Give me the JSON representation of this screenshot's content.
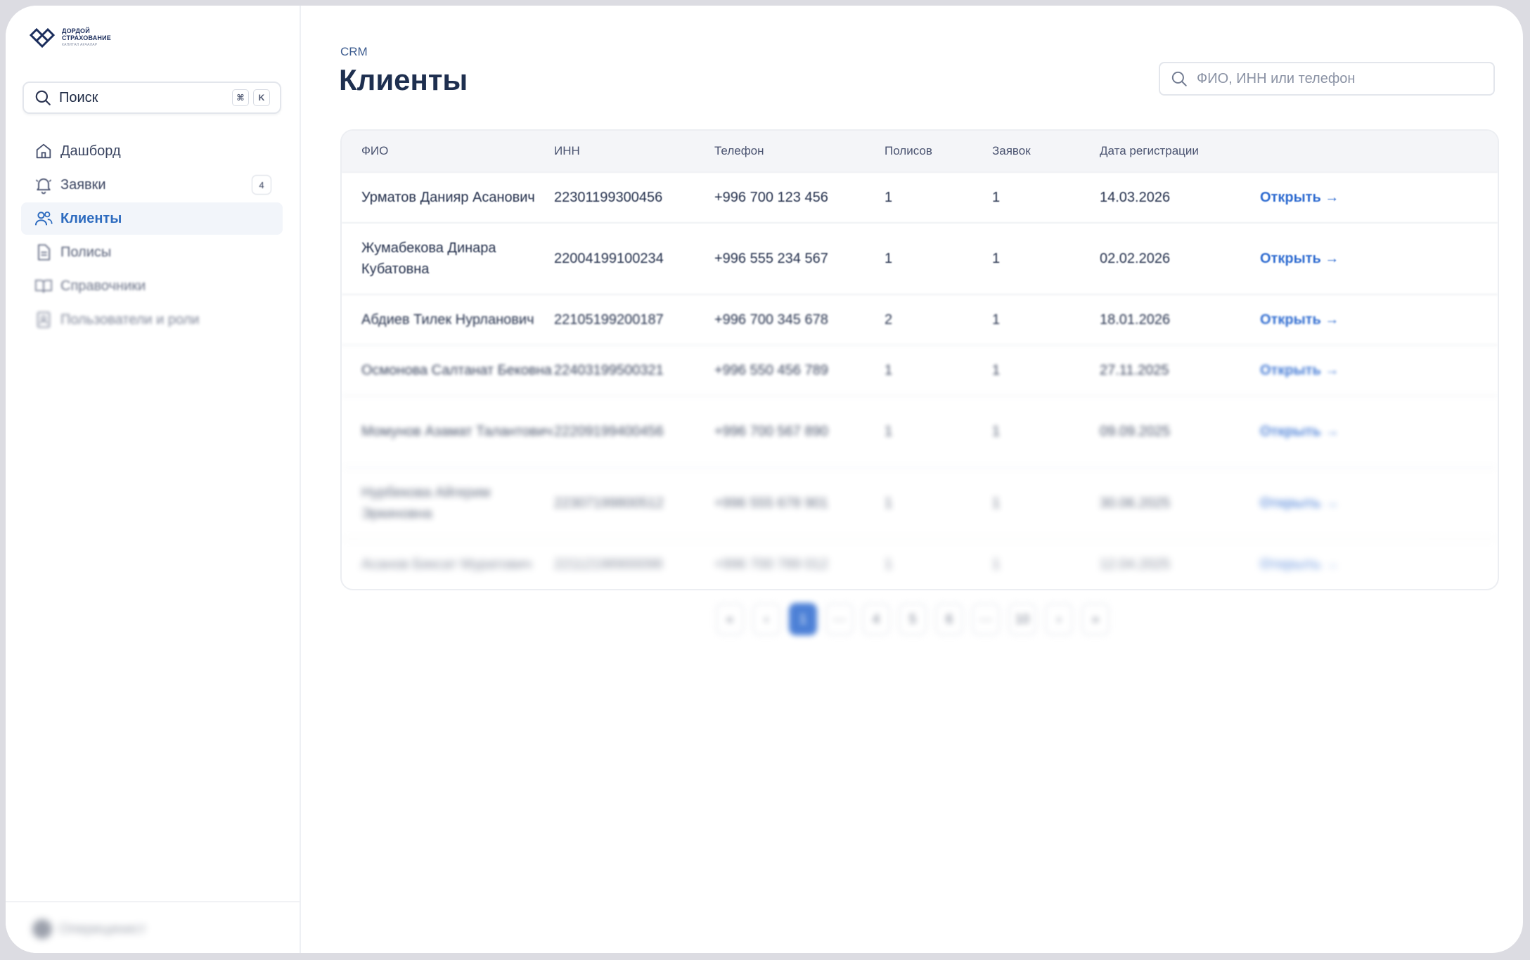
{
  "sidebar": {
    "logo": {
      "line1": "ДОРДОЙ",
      "line2": "СТРАХОВАНИЕ",
      "line3": "КАПИТАЛ АКЧАЛАР"
    },
    "search": {
      "label": "Поиск",
      "kbd1": "⌘",
      "kbd2": "K"
    },
    "items": [
      {
        "label": "Дашборд",
        "icon": "home-icon"
      },
      {
        "label": "Заявки",
        "icon": "bell-icon",
        "badge": "4"
      },
      {
        "label": "Клиенты",
        "icon": "users-icon",
        "active": true
      },
      {
        "label": "Полисы",
        "icon": "document-icon"
      },
      {
        "label": "Справочники",
        "icon": "book-icon"
      },
      {
        "label": "Пользователи и роли",
        "icon": "id-card-icon"
      }
    ],
    "user": {
      "name": "Оперецинист"
    }
  },
  "header": {
    "breadcrumb": "CRM",
    "title": "Клиенты",
    "search_placeholder": "ФИО, ИНН или телефон"
  },
  "table": {
    "columns": [
      "ФИО",
      "ИНН",
      "Телефон",
      "Полисов",
      "Заявок",
      "Дата регистрации"
    ],
    "rows": [
      {
        "name": "Урматов Данияр Асанович",
        "inn": "22301199300456",
        "phone": "+996 700 123 456",
        "policies": "1",
        "requests": "1",
        "date": "14.03.2026",
        "action": "Открыть →"
      },
      {
        "name": "Жумабекова Динара Кубатовна",
        "inn": "22004199100234",
        "phone": "+996 555 234 567",
        "policies": "1",
        "requests": "1",
        "date": "02.02.2026",
        "action": "Открыть →"
      },
      {
        "name": "Абдиев Тилек Нурланович",
        "inn": "22105199200187",
        "phone": "+996 700 345 678",
        "policies": "2",
        "requests": "1",
        "date": "18.01.2026",
        "action": "Открыть →"
      },
      {
        "name": "Осмонова Салтанат Бековна",
        "inn": "22403199500321",
        "phone": "+996 550 456 789",
        "policies": "1",
        "requests": "1",
        "date": "27.11.2025",
        "action": "Открыть →"
      },
      {
        "name": "Момунов Азамат Талантович",
        "inn": "22209199400456",
        "phone": "+996 700 567 890",
        "policies": "1",
        "requests": "1",
        "date": "09.09.2025",
        "action": "Открыть →"
      },
      {
        "name": "Нурбекова Айгерим Эркиновна",
        "inn": "22307199800512",
        "phone": "+996 555 678 901",
        "policies": "1",
        "requests": "1",
        "date": "30.06.2025",
        "action": "Открыть →"
      },
      {
        "name": "Асанов Бексат Муратович",
        "inn": "22112198900098",
        "phone": "+996 700 789 012",
        "policies": "1",
        "requests": "1",
        "date": "12.04.2025",
        "action": "Открыть →"
      }
    ]
  },
  "pagination": {
    "first": "«",
    "prev": "‹",
    "pages": [
      "1",
      "···",
      "4",
      "5",
      "6",
      "···",
      "10"
    ],
    "active_page": "1",
    "next": "›",
    "last": "»"
  },
  "colors": {
    "accent": "#2e6bd0",
    "title": "#1e2f4f",
    "active_nav_bg": "#f2f5fa"
  }
}
